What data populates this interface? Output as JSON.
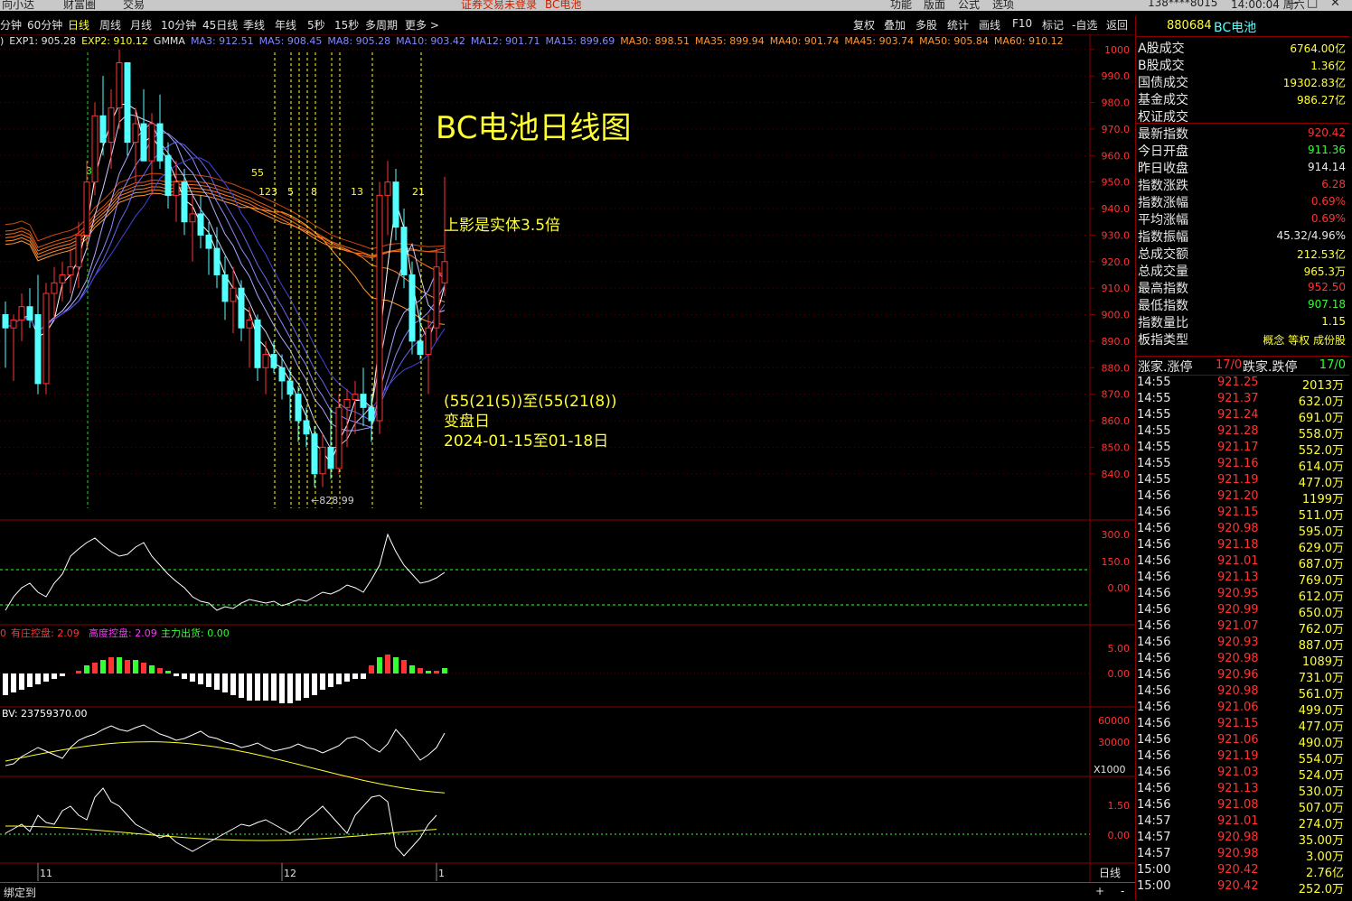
{
  "top_bar": {
    "items": [
      "向小达",
      "财富圈",
      "交易",
      "证券交易未登录",
      "BC电池",
      "功能",
      "版面",
      "公式",
      "选项",
      "138****8015",
      "14:00:04 周六"
    ]
  },
  "toolbar": {
    "periods": [
      "分钟",
      "60分钟",
      "日线",
      "周线",
      "月线",
      "10分钟",
      "45日线",
      "季线",
      "年线",
      "5秒",
      "15秒",
      "多周期",
      "更多 >"
    ],
    "active_period": "日线",
    "right_tools": [
      "复权",
      "叠加",
      "多股",
      "统计",
      "画线",
      "F10",
      "标记",
      "-自选",
      "返回"
    ]
  },
  "legend": {
    "items": [
      {
        "text": ")",
        "color": "#e0e0e0"
      },
      {
        "text": "EXP1: 905.28",
        "color": "#e0e0e0"
      },
      {
        "text": "EXP2: 910.12",
        "color": "#ffff33"
      },
      {
        "text": "GMMA",
        "color": "#e0e0e0"
      },
      {
        "text": "MA3: 912.51",
        "color": "#8888ff"
      },
      {
        "text": "MA5: 908.45",
        "color": "#8888ff"
      },
      {
        "text": "MA8: 905.28",
        "color": "#8888ff"
      },
      {
        "text": "MA10: 903.42",
        "color": "#8888ff"
      },
      {
        "text": "MA12: 901.71",
        "color": "#8888ff"
      },
      {
        "text": "MA15: 899.69",
        "color": "#8888ff"
      },
      {
        "text": "MA30: 898.51",
        "color": "#ff9933"
      },
      {
        "text": "MA35: 899.94",
        "color": "#ff9933"
      },
      {
        "text": "MA40: 901.74",
        "color": "#ff9933"
      },
      {
        "text": "MA45: 903.74",
        "color": "#ff9933"
      },
      {
        "text": "MA50: 905.84",
        "color": "#ff9933"
      },
      {
        "text": "MA60: 910.12",
        "color": "#ff9933"
      }
    ]
  },
  "price_axis": [
    "1000",
    "990.0",
    "980.0",
    "970.0",
    "960.0",
    "950.0",
    "940.0",
    "930.0",
    "920.0",
    "910.0",
    "900.0",
    "890.0",
    "880.0",
    "870.0",
    "860.0",
    "850.0",
    "840.0"
  ],
  "fib_labels": [
    "34",
    "55",
    "1",
    "2",
    "3",
    "5",
    "8",
    "13",
    "21"
  ],
  "low_marker": "←828.99",
  "annotations": {
    "title": "BC电池日线图",
    "upper_shadow": "上影是实体3.5倍",
    "turn_line1": "(55(21(5))至(55(21(8))",
    "turn_line2": "变盘日",
    "turn_line3": "2024-01-15至01-18日"
  },
  "sub1": {
    "axis": [
      "300.0",
      "150.0",
      "0.00"
    ]
  },
  "sub2": {
    "legend": [
      {
        "text": "0",
        "color": "#ff3333"
      },
      {
        "text": "有庄控盘: 2.09",
        "color": "#ff3333"
      },
      {
        "text": "高度控盘: 2.09",
        "color": "#ff33ff"
      },
      {
        "text": "主力出货: 0.00",
        "color": "#33ff33"
      }
    ],
    "axis": [
      "5.00",
      "0.00"
    ]
  },
  "sub3": {
    "legend": "BV: 23759370.00",
    "axis": [
      "60000",
      "30000"
    ],
    "unit": "X1000"
  },
  "sub4": {
    "axis": [
      "1.50",
      "0.00"
    ]
  },
  "date_axis": [
    "11",
    "12",
    "1"
  ],
  "bottom": {
    "left": "绑定到",
    "period": "日线"
  },
  "colors": {
    "up": "#ff3333",
    "down": "#54ffff",
    "yellow": "#ffff33",
    "orange": "#ff9933",
    "axis": "#8a0000"
  },
  "right_panel": {
    "code": "880684",
    "name": "BC电池",
    "stats": [
      {
        "label": "A股成交",
        "value": "6764.00亿",
        "color": "#ffff33"
      },
      {
        "label": "B股成交",
        "value": "1.36亿",
        "color": "#ffff33"
      },
      {
        "label": "国债成交",
        "value": "19302.83亿",
        "color": "#ffff33"
      },
      {
        "label": "基金成交",
        "value": "986.27亿",
        "color": "#ffff33"
      },
      {
        "label": "权证成交",
        "value": "",
        "color": "#ffff33"
      },
      {
        "label": "最新指数",
        "value": "920.42",
        "color": "#ff3333"
      },
      {
        "label": "今日开盘",
        "value": "911.36",
        "color": "#33ff33"
      },
      {
        "label": "昨日收盘",
        "value": "914.14",
        "color": "#e8e8e8"
      },
      {
        "label": "指数涨跌",
        "value": "6.28",
        "color": "#ff3333"
      },
      {
        "label": "指数涨幅",
        "value": "0.69%",
        "color": "#ff3333"
      },
      {
        "label": "平均涨幅",
        "value": "0.69%",
        "color": "#ff3333"
      },
      {
        "label": "指数振幅",
        "value": "45.32/4.96%",
        "color": "#e8e8e8"
      },
      {
        "label": "总成交额",
        "value": "212.53亿",
        "color": "#ffff33"
      },
      {
        "label": "总成交量",
        "value": "965.3万",
        "color": "#ffff33"
      },
      {
        "label": "最高指数",
        "value": "952.50",
        "color": "#ff3333"
      },
      {
        "label": "最低指数",
        "value": "907.18",
        "color": "#33ff33"
      },
      {
        "label": "指数量比",
        "value": "1.15",
        "color": "#ffff33"
      },
      {
        "label": "板指类型",
        "value": "概念 等权 成份股",
        "color": "#ffff33"
      }
    ],
    "rise_fall": {
      "label1": "涨家.涨停",
      "val1": "17/0",
      "label2": "跌家.跌停",
      "val2": "17/0"
    },
    "ticks": [
      {
        "time": "14:55",
        "price": "921.25",
        "vol": "2013万"
      },
      {
        "time": "14:55",
        "price": "921.37",
        "vol": "632.0万"
      },
      {
        "time": "14:55",
        "price": "921.24",
        "vol": "691.0万"
      },
      {
        "time": "14:55",
        "price": "921.28",
        "vol": "558.0万"
      },
      {
        "time": "14:55",
        "price": "921.17",
        "vol": "552.0万"
      },
      {
        "time": "14:55",
        "price": "921.16",
        "vol": "614.0万"
      },
      {
        "time": "14:55",
        "price": "921.19",
        "vol": "477.0万"
      },
      {
        "time": "14:56",
        "price": "921.20",
        "vol": "1199万"
      },
      {
        "time": "14:56",
        "price": "921.15",
        "vol": "511.0万"
      },
      {
        "time": "14:56",
        "price": "920.98",
        "vol": "595.0万"
      },
      {
        "time": "14:56",
        "price": "921.18",
        "vol": "629.0万"
      },
      {
        "time": "14:56",
        "price": "921.01",
        "vol": "687.0万"
      },
      {
        "time": "14:56",
        "price": "921.13",
        "vol": "769.0万"
      },
      {
        "time": "14:56",
        "price": "920.95",
        "vol": "612.0万"
      },
      {
        "time": "14:56",
        "price": "920.99",
        "vol": "650.0万"
      },
      {
        "time": "14:56",
        "price": "921.07",
        "vol": "762.0万"
      },
      {
        "time": "14:56",
        "price": "920.93",
        "vol": "887.0万"
      },
      {
        "time": "14:56",
        "price": "920.98",
        "vol": "1089万"
      },
      {
        "time": "14:56",
        "price": "920.96",
        "vol": "731.0万"
      },
      {
        "time": "14:56",
        "price": "920.98",
        "vol": "561.0万"
      },
      {
        "time": "14:56",
        "price": "921.06",
        "vol": "499.0万"
      },
      {
        "time": "14:56",
        "price": "921.15",
        "vol": "477.0万"
      },
      {
        "time": "14:56",
        "price": "921.06",
        "vol": "490.0万"
      },
      {
        "time": "14:56",
        "price": "921.19",
        "vol": "554.0万"
      },
      {
        "time": "14:56",
        "price": "921.03",
        "vol": "524.0万"
      },
      {
        "time": "14:56",
        "price": "921.13",
        "vol": "530.0万"
      },
      {
        "time": "14:56",
        "price": "921.08",
        "vol": "507.0万"
      },
      {
        "time": "14:57",
        "price": "921.01",
        "vol": "274.0万"
      },
      {
        "time": "14:57",
        "price": "920.98",
        "vol": "35.00万"
      },
      {
        "time": "14:57",
        "price": "920.98",
        "vol": "3.00万"
      },
      {
        "time": "15:00",
        "price": "920.42",
        "vol": "2.76亿"
      },
      {
        "time": "15:00",
        "price": "920.42",
        "vol": "252.0万"
      }
    ]
  },
  "chart_data": {
    "type": "candlestick",
    "title": "BC电池日线图",
    "ylim": [
      828,
      1003
    ],
    "low": 828.99,
    "date_ticks": [
      {
        "label": "11",
        "index": 4
      },
      {
        "label": "12",
        "index": 34
      },
      {
        "label": "1",
        "index": 53
      }
    ],
    "ohlc": [
      [
        900,
        905,
        880,
        895
      ],
      [
        895,
        900,
        875,
        898
      ],
      [
        898,
        908,
        890,
        903
      ],
      [
        903,
        910,
        895,
        898
      ],
      [
        900,
        915,
        870,
        874
      ],
      [
        874,
        912,
        870,
        908
      ],
      [
        908,
        918,
        898,
        912
      ],
      [
        912,
        920,
        905,
        915
      ],
      [
        915,
        925,
        908,
        918
      ],
      [
        918,
        935,
        910,
        930
      ],
      [
        930,
        958,
        925,
        950
      ],
      [
        950,
        980,
        945,
        975
      ],
      [
        975,
        990,
        960,
        965
      ],
      [
        965,
        985,
        955,
        978
      ],
      [
        978,
        1000,
        970,
        995
      ],
      [
        995,
        990,
        960,
        965
      ],
      [
        965,
        978,
        950,
        972
      ],
      [
        972,
        985,
        960,
        958
      ],
      [
        958,
        976,
        945,
        972
      ],
      [
        972,
        983,
        955,
        958
      ],
      [
        960,
        965,
        940,
        945
      ],
      [
        945,
        958,
        935,
        950
      ],
      [
        950,
        955,
        930,
        935
      ],
      [
        935,
        945,
        920,
        938
      ],
      [
        938,
        945,
        925,
        930
      ],
      [
        930,
        935,
        915,
        925
      ],
      [
        925,
        933,
        910,
        915
      ],
      [
        915,
        922,
        898,
        905
      ],
      [
        905,
        918,
        893,
        910
      ],
      [
        910,
        913,
        890,
        895
      ],
      [
        895,
        903,
        880,
        898
      ],
      [
        898,
        900,
        875,
        880
      ],
      [
        880,
        890,
        870,
        885
      ],
      [
        885,
        890,
        878,
        880
      ],
      [
        880,
        885,
        868,
        875
      ],
      [
        875,
        880,
        860,
        870
      ],
      [
        870,
        873,
        852,
        860
      ],
      [
        860,
        865,
        850,
        855
      ],
      [
        855,
        858,
        835,
        840
      ],
      [
        840,
        855,
        835,
        850
      ],
      [
        850,
        865,
        838,
        842
      ],
      [
        842,
        870,
        840,
        865
      ],
      [
        865,
        872,
        850,
        868
      ],
      [
        868,
        875,
        855,
        870
      ],
      [
        870,
        880,
        858,
        865
      ],
      [
        865,
        870,
        852,
        860
      ],
      [
        860,
        950,
        855,
        945
      ],
      [
        945,
        958,
        930,
        950
      ],
      [
        950,
        955,
        928,
        933
      ],
      [
        933,
        940,
        910,
        915
      ],
      [
        915,
        920,
        885,
        890
      ],
      [
        890,
        902,
        883,
        885
      ],
      [
        885,
        900,
        870,
        895
      ],
      [
        895,
        925,
        890,
        918
      ],
      [
        912,
        952,
        907,
        920
      ]
    ]
  }
}
